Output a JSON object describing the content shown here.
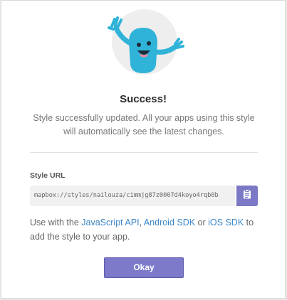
{
  "dialog": {
    "title": "Success!",
    "message": "Style successfully updated. All your apps using this style will automatically see the latest changes.",
    "style_url_label": "Style URL",
    "style_url_value": "mapbox://styles/nailouza/cimmjg87z0007d4koyo4rqb0b",
    "help": {
      "prefix": "Use with the ",
      "link_js": "JavaScript API",
      "sep1": ", ",
      "link_android": "Android SDK",
      "sep2": " or ",
      "link_ios": "iOS SDK",
      "suffix": " to add the style to your app."
    },
    "okay_button": "Okay"
  },
  "colors": {
    "accent": "#7c7ac9",
    "link": "#3b86c6",
    "mascot": "#2fb3d8"
  },
  "icons": {
    "mascot": "waving-mascot-icon",
    "copy": "clipboard-icon"
  }
}
